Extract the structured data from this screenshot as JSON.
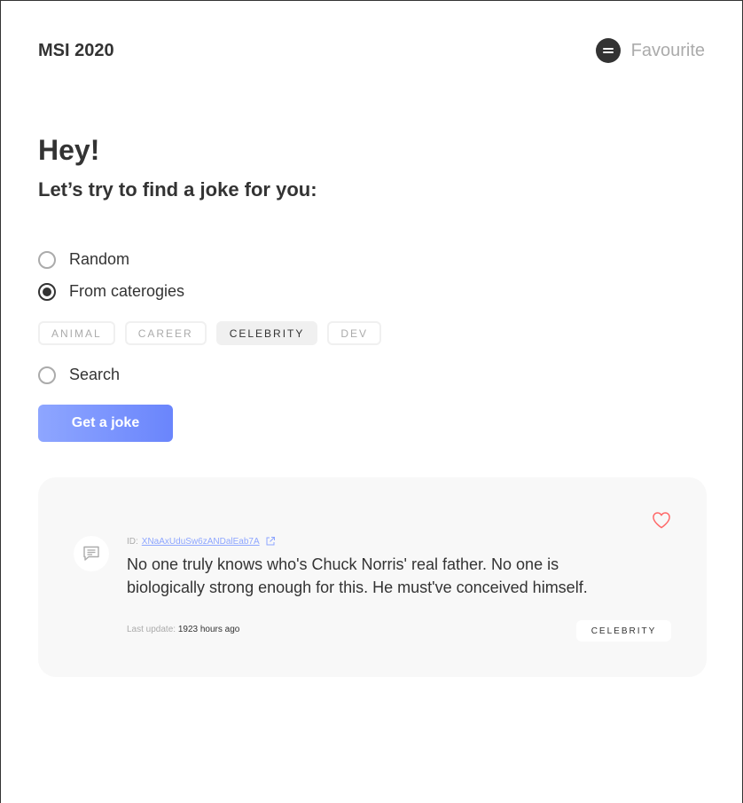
{
  "header": {
    "brand": "MSI 2020",
    "favourite_label": "Favourite"
  },
  "intro": {
    "greeting": "Hey!",
    "subtitle": "Let’s try to find a joke for you:"
  },
  "options": {
    "random_label": "Random",
    "categories_label": "From caterogies",
    "search_label": "Search",
    "selected": "From caterogies"
  },
  "categories": {
    "items": [
      "ANIMAL",
      "CAREER",
      "CELEBRITY",
      "DEV"
    ],
    "selected": "CELEBRITY"
  },
  "action": {
    "get_joke_label": "Get a joke"
  },
  "joke": {
    "id_prefix": "ID:",
    "id": "XNaAxUduSw6zANDalEab7A",
    "text": "No one truly knows who's Chuck Norris' real father. No one is biologically strong enough for this. He must've conceived himself.",
    "last_update_label": "Last update:",
    "last_update_value": "1923 hours ago",
    "category": "CELEBRITY"
  },
  "colors": {
    "accent": "#8ea6ff",
    "accent_dark": "#6a85fc",
    "heart": "#ff6767",
    "text": "#333333",
    "muted": "#ababab",
    "card_bg": "#f8f8f8"
  },
  "icons": {
    "favourite": "menu-icon",
    "message": "chat-message-icon",
    "like": "heart-outline-icon",
    "link": "external-link-icon"
  }
}
